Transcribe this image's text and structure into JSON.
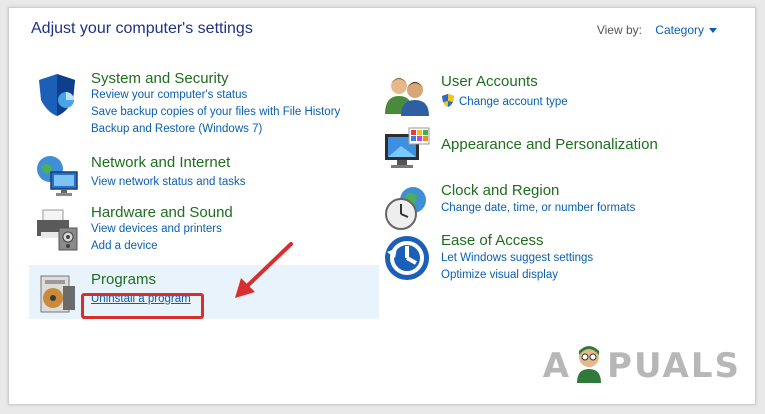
{
  "header": {
    "title": "Adjust your computer's settings",
    "view_by_label": "View by:",
    "view_by_value": "Category"
  },
  "left": [
    {
      "head": "System and Security",
      "links": [
        "Review your computer's status",
        "Save backup copies of your files with File History",
        "Backup and Restore (Windows 7)"
      ]
    },
    {
      "head": "Network and Internet",
      "links": [
        "View network status and tasks"
      ]
    },
    {
      "head": "Hardware and Sound",
      "links": [
        "View devices and printers",
        "Add a device"
      ]
    },
    {
      "head": "Programs",
      "links": [
        "Uninstall a program"
      ]
    }
  ],
  "right": [
    {
      "head": "User Accounts",
      "links": [
        "Change account type"
      ]
    },
    {
      "head": "Appearance and Personalization",
      "links": []
    },
    {
      "head": "Clock and Region",
      "links": [
        "Change date, time, or number formats"
      ]
    },
    {
      "head": "Ease of Access",
      "links": [
        "Let Windows suggest settings",
        "Optimize visual display"
      ]
    }
  ],
  "watermark": "APPUALS",
  "colors": {
    "heading": "#1e6e1e",
    "link": "#0a5fb4",
    "title": "#1e3287",
    "highlight": "#e8f3fc",
    "annotation": "#d92e2e"
  },
  "icons": {
    "system_security": "shield-icon",
    "network": "globe-network-icon",
    "hardware": "printer-icon",
    "programs": "programs-disc-icon",
    "users": "users-icon",
    "appearance": "monitor-palette-icon",
    "clock": "clock-globe-icon",
    "ease": "ease-of-access-icon"
  }
}
